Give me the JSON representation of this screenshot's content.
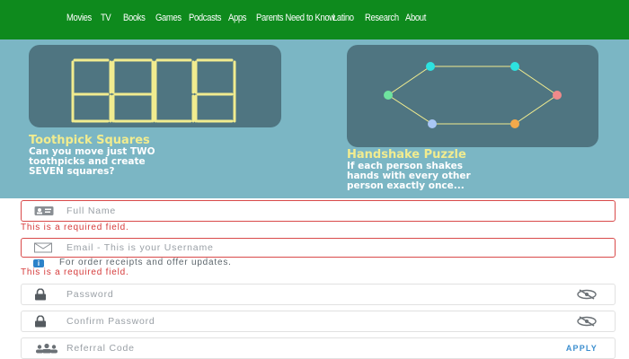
{
  "nav": {
    "items": [
      "Movies",
      "TV",
      "Books",
      "Games",
      "Podcasts",
      "Apps",
      "Parents Need to Know",
      "Latino",
      "Research",
      "About"
    ]
  },
  "colors": {
    "nav_bg": "#0e8a1d",
    "hero_bg": "#7bb6c4",
    "card_bg": "#4f7581",
    "title_yellow": "#f1ec8f",
    "error_red": "#d94a4a",
    "apply_blue": "#3d8fcf"
  },
  "puzzles": [
    {
      "title": "Toothpick Squares",
      "description_lines": [
        "Can you move just TWO",
        "toothpicks and create",
        "SEVEN squares?"
      ],
      "icon": "toothpick-grid-illustration"
    },
    {
      "title": "Handshake Puzzle",
      "description_lines": [
        "If each person shakes",
        "hands with every other",
        "person exactly once..."
      ],
      "icon": "handshake-octagon-illustration"
    }
  ],
  "form": {
    "full_name": {
      "placeholder": "Full Name",
      "error": "This is a required field.",
      "icon": "id-card-icon"
    },
    "email": {
      "placeholder": "Email - This is your Username",
      "hint": "For order receipts and offer updates.",
      "error": "This is a required field.",
      "icon": "envelope-icon",
      "hint_icon": "info-icon"
    },
    "password": {
      "placeholder": "Password",
      "icon": "lock-icon",
      "toggle_icon": "eye-slash-icon"
    },
    "confirm_password": {
      "placeholder": "Confirm Password",
      "icon": "lock-icon",
      "toggle_icon": "eye-slash-icon"
    },
    "referral": {
      "placeholder": "Referral Code",
      "icon": "group-icon",
      "apply_label": "APPLY"
    }
  }
}
